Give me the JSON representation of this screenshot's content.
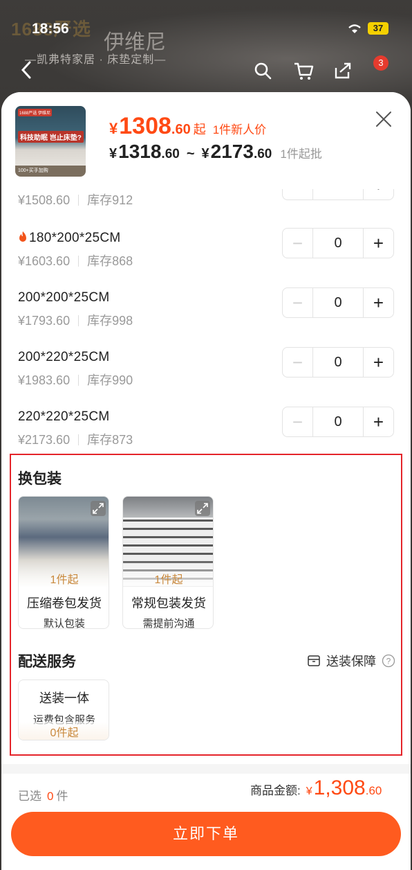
{
  "status": {
    "time": "18:56",
    "battery": "37"
  },
  "background": {
    "brand_left": "1688严选",
    "brand_cn": "伊维尼",
    "slogan": "—凯弗特家居 · 床垫定制—",
    "notif_count": "3"
  },
  "product": {
    "thumb_tag": "1688严选 伊维尼",
    "thumb_title": "科技助眠 岂止床垫?",
    "thumb_footer": "100+买手加购",
    "price_currency": "¥",
    "price_int": "1308",
    "price_dec": ".60",
    "price_qi": "起",
    "price_tag": "1件新人价",
    "range_low_cur": "¥",
    "range_low_int": "1318",
    "range_low_dec": ".60",
    "range_sep": "~",
    "range_high_cur": "¥",
    "range_high_int": "2173",
    "range_high_dec": ".60",
    "moq": "1件起批"
  },
  "skus": [
    {
      "name": "",
      "price": "¥1508.60",
      "stock": "库存912",
      "qty": "0"
    },
    {
      "name": "180*200*25CM",
      "hot": true,
      "price": "¥1603.60",
      "stock": "库存868",
      "qty": "0"
    },
    {
      "name": "200*200*25CM",
      "price": "¥1793.60",
      "stock": "库存998",
      "qty": "0"
    },
    {
      "name": "200*220*25CM",
      "price": "¥1983.60",
      "stock": "库存990",
      "qty": "0"
    },
    {
      "name": "220*220*25CM",
      "price": "¥2173.60",
      "stock": "库存873",
      "qty": "0"
    }
  ],
  "packaging": {
    "title": "换包装",
    "options": [
      {
        "moq": "1件起",
        "name": "压缩卷包发货",
        "sub": "默认包装"
      },
      {
        "moq": "1件起",
        "name": "常规包装发货",
        "sub": "需提前沟通"
      }
    ]
  },
  "delivery": {
    "title": "配送服务",
    "guarantee": "送装保障",
    "option": {
      "name": "送装一体",
      "sub": "运费包含服务",
      "moq": "0件起"
    }
  },
  "footer": {
    "selected_label": "已选",
    "selected_count": "0",
    "selected_unit": "件",
    "total_label": "商品金额:",
    "total_cur": "¥",
    "total_int": "1,308",
    "total_dec": ".60",
    "order_label": "立即下单"
  },
  "colors": {
    "accent": "#ff4a14",
    "button": "#ff5b1f",
    "highlight_box": "#e4242a",
    "moq_gold": "#c9893d"
  }
}
